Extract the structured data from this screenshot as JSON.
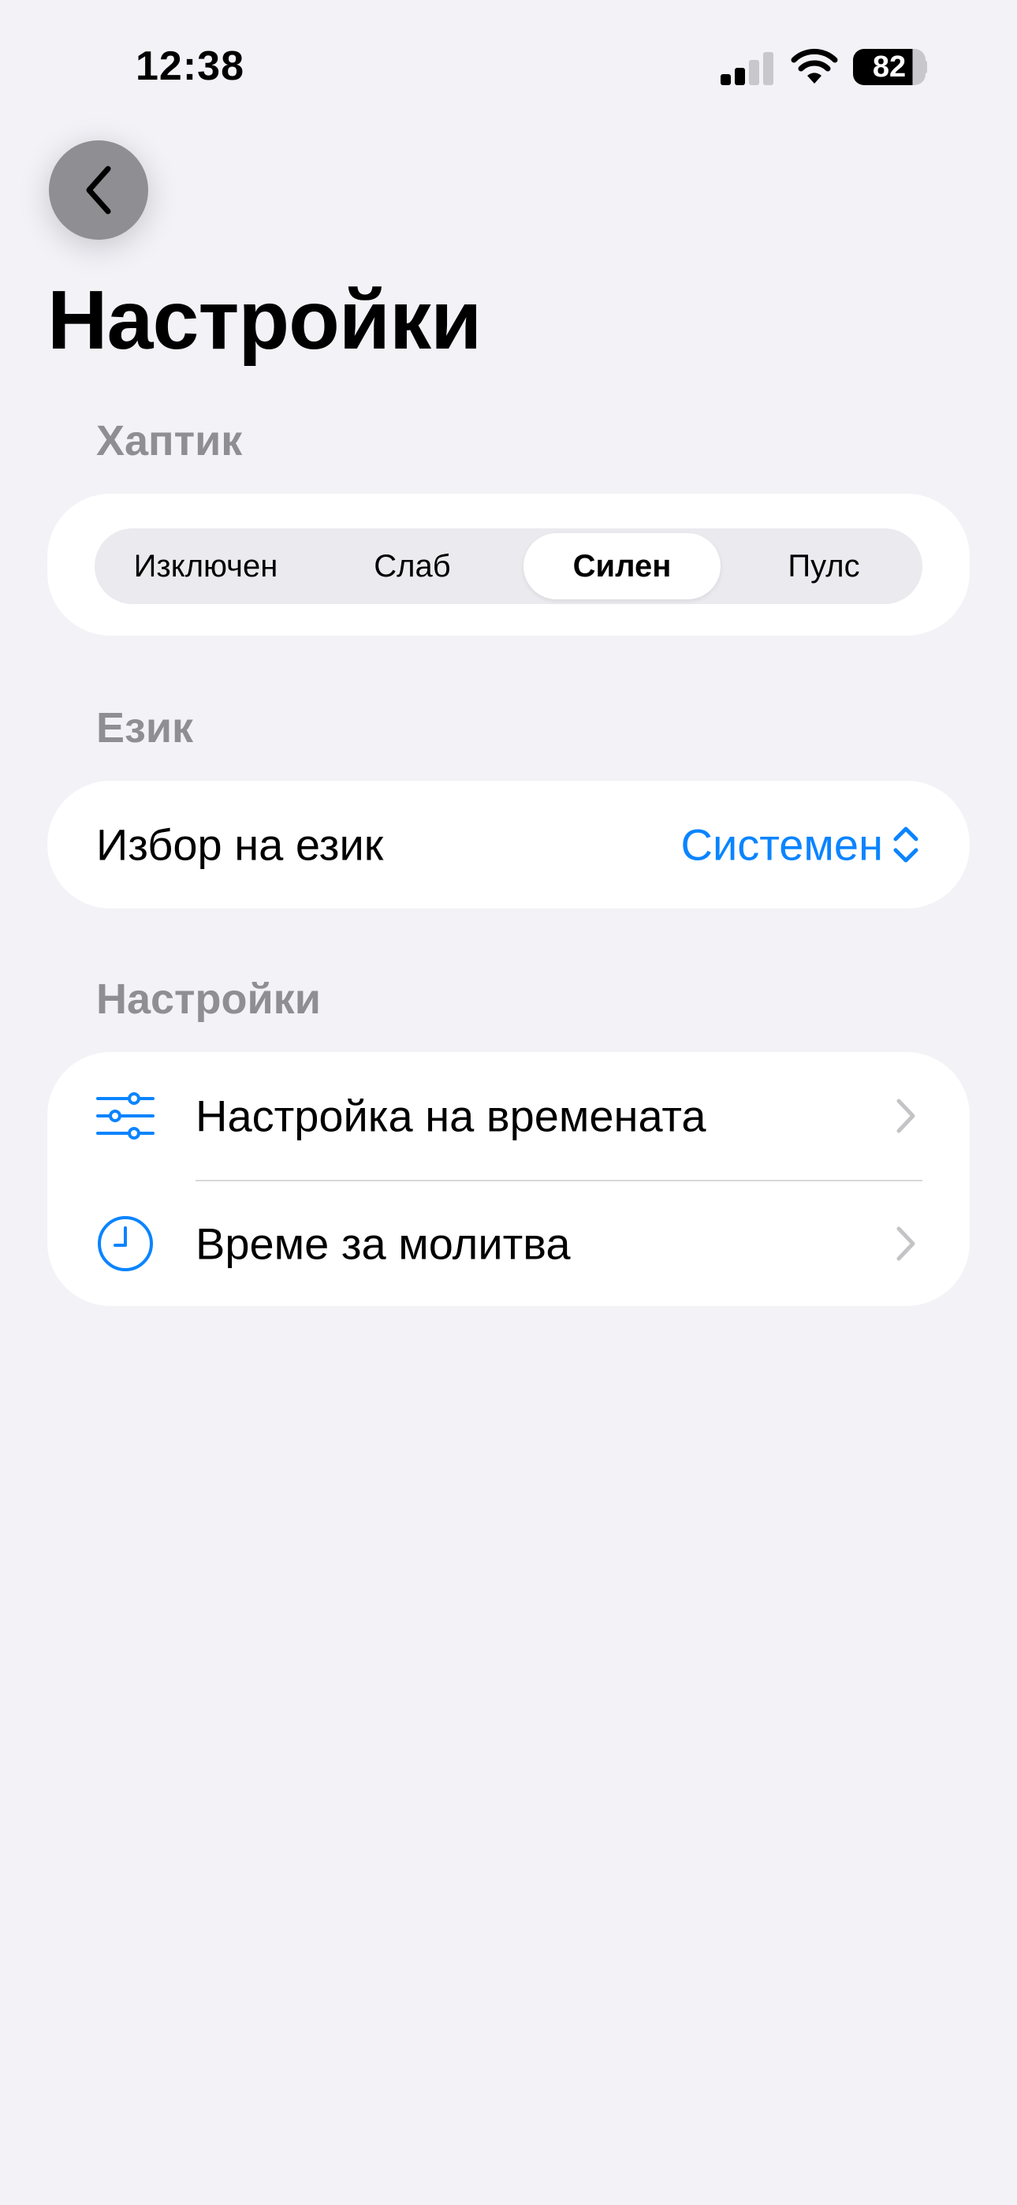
{
  "status_bar": {
    "time": "12:38",
    "battery": "82"
  },
  "header": {
    "title": "Настройки"
  },
  "haptic_section": {
    "header": "Хаптик",
    "segments": [
      "Изключен",
      "Слаб",
      "Силен",
      "Пулс"
    ],
    "selected": "Силен"
  },
  "language_section": {
    "header": "Език",
    "label": "Избор на език",
    "value": "Системен"
  },
  "settings_section": {
    "header": "Настройки",
    "items": [
      {
        "label": "Настройка на времената",
        "icon": "sliders-icon"
      },
      {
        "label": "Време за молитва",
        "icon": "clock-icon"
      }
    ]
  },
  "colors": {
    "accent": "#0a84ff",
    "background": "#f2f2f7",
    "secondary_text": "#8e8e93"
  }
}
